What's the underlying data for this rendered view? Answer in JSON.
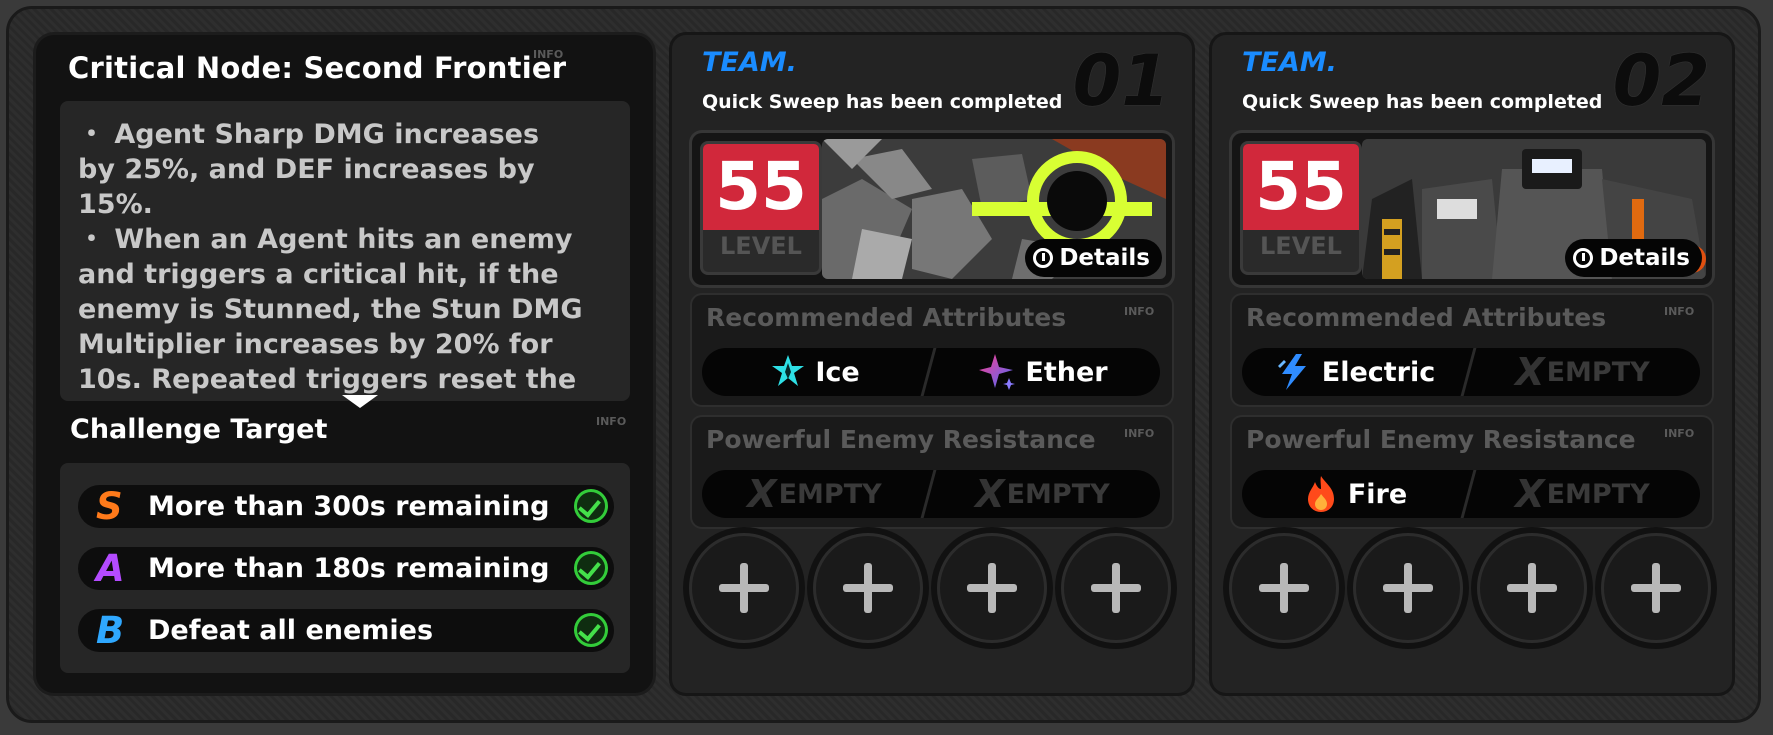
{
  "left_panel": {
    "title": "Critical Node: Second Frontier",
    "info": "INFO",
    "description_lines": [
      "・ Agent Sharp DMG increases",
      "by 25%, and DEF increases by",
      "15%.",
      "・ When an Agent hits an enemy",
      "and triggers a critical hit, if the",
      "enemy is Stunned, the Stun DMG",
      "Multiplier increases by 20% for",
      "10s. Repeated triggers reset the"
    ],
    "challenge_title": "Challenge Target",
    "challenge_info": "INFO",
    "targets": [
      {
        "grade": "S",
        "text": "More than 300s remaining",
        "grade_color": "#ff7a1a",
        "completed": true
      },
      {
        "grade": "A",
        "text": "More than 180s remaining",
        "grade_color": "#b44bff",
        "completed": true
      },
      {
        "grade": "B",
        "text": "Defeat all enemies",
        "grade_color": "#2fa8ff",
        "completed": true
      }
    ]
  },
  "teams": [
    {
      "label": "TEAM.",
      "number": "01",
      "status": "Quick Sweep has been completed",
      "level": "55",
      "level_word": "LEVEL",
      "details_label": "Details",
      "recommended_title": "Recommended Attributes",
      "recommended_info": "INFO",
      "recommended": [
        {
          "name": "Ice",
          "icon": "ice-icon",
          "empty": false
        },
        {
          "name": "Ether",
          "icon": "ether-icon",
          "empty": false
        }
      ],
      "resistance_title": "Powerful Enemy Resistance",
      "resistance_info": "INFO",
      "resistance": [
        {
          "name": "EMPTY",
          "icon": "x-icon",
          "empty": true
        },
        {
          "name": "EMPTY",
          "icon": "x-icon",
          "empty": true
        }
      ],
      "art": "yellow-ring-enemy"
    },
    {
      "label": "TEAM.",
      "number": "02",
      "status": "Quick Sweep has been completed",
      "level": "55",
      "level_word": "LEVEL",
      "details_label": "Details",
      "recommended_title": "Recommended Attributes",
      "recommended_info": "INFO",
      "recommended": [
        {
          "name": "Electric",
          "icon": "electric-icon",
          "empty": false
        },
        {
          "name": "EMPTY",
          "icon": "x-icon",
          "empty": true
        }
      ],
      "resistance_title": "Powerful Enemy Resistance",
      "resistance_info": "INFO",
      "resistance": [
        {
          "name": "Fire",
          "icon": "fire-icon",
          "empty": false
        },
        {
          "name": "EMPTY",
          "icon": "x-icon",
          "empty": true
        }
      ],
      "art": "mech-enemy"
    }
  ]
}
